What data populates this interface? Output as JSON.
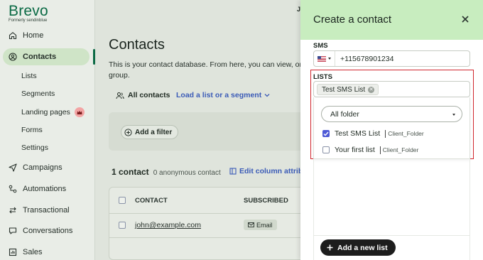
{
  "brand": {
    "name": "Brevo",
    "tagline": "Formerly sendinblue"
  },
  "sidebar": {
    "items": [
      {
        "label": "Home",
        "icon": "home-icon"
      },
      {
        "label": "Contacts",
        "icon": "user-circle-icon",
        "active": true
      },
      {
        "label": "Campaigns",
        "icon": "send-icon"
      },
      {
        "label": "Automations",
        "icon": "automation-icon"
      },
      {
        "label": "Transactional",
        "icon": "swap-icon"
      },
      {
        "label": "Conversations",
        "icon": "chat-icon"
      },
      {
        "label": "Sales",
        "icon": "sales-icon"
      }
    ],
    "contacts_sub": [
      "Lists",
      "Segments",
      "Landing pages",
      "Forms",
      "Settings"
    ]
  },
  "main": {
    "title": "Contacts",
    "description": "This is your contact database. From here, you can view, organ group.",
    "description_line1": "This is your contact database. From here, you can view, organ",
    "description_line2": "group.",
    "tab_all": "All contacts",
    "tab_load": "Load a list or a segment",
    "add_filter": "Add a filter",
    "count_bold": "1 contact",
    "count_sub": "0 anonymous contact",
    "edit_columns": "Edit column attribu",
    "columns": [
      "CONTACT",
      "SUBSCRIBED"
    ],
    "rows": [
      {
        "email": "john@example.com",
        "subscribed": "Email"
      }
    ],
    "user_initial": "J"
  },
  "panel": {
    "title": "Create a contact",
    "sms_label": "SMS",
    "sms_value": "+115678901234",
    "lists_label": "LISTS",
    "selected_tag": "Test SMS List",
    "folder_select": "All folder",
    "options": [
      {
        "name": "Test SMS List",
        "folder": "Client_Folder",
        "checked": true
      },
      {
        "name": "Your first list",
        "folder": "Client_Folder",
        "checked": false
      }
    ],
    "add_list_button": "Add a new list",
    "highlight_color": "#d0252c"
  },
  "colors": {
    "brand_green": "#0b6a45",
    "panel_header": "#c8edbf",
    "link_blue": "#3b5bb7",
    "checkbox_blue": "#4e5ad6"
  }
}
